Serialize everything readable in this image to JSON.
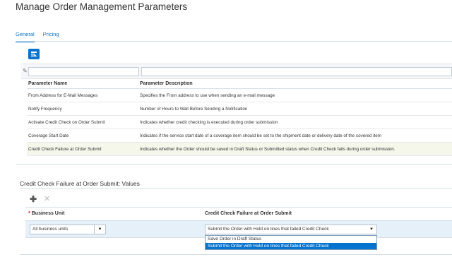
{
  "page": {
    "title": "Manage Order Management Parameters"
  },
  "tabs": [
    {
      "label": "General",
      "active": true
    },
    {
      "label": "Pricing",
      "active": false
    }
  ],
  "toolbar": {
    "action_icon": "edit-query-icon"
  },
  "grid": {
    "columns": [
      "Parameter Name",
      "Parameter Description"
    ],
    "rows": [
      {
        "name": "From Address for E-Mail Messages",
        "description": "Specifies the From address to use when sending an e-mail message"
      },
      {
        "name": "Notify Frequency",
        "description": "Number of Hours to Wait Before Sending a Notification"
      },
      {
        "name": "Activate Credit Check on Order Submit",
        "description": "Indicates whether credit checking is executed during order submission"
      },
      {
        "name": "Coverage Start Date",
        "description": "Indicates if the service start date of a coverage item should be set to the shipment date or delivery date of the covered item"
      },
      {
        "name": "Credit Check Failure at Order Submit",
        "description": "Indicates whether the Order should be saved in Draft Status or Submitted status when Credit Check fails during order submission."
      }
    ],
    "selected_row": 4
  },
  "values_section": {
    "title": "Credit Check Failure at Order Submit: Values",
    "columns": {
      "required_mark": "*",
      "business_unit": "Business Unit",
      "credit_check": "Credit Check Failure at Order Submit"
    },
    "row": {
      "business_unit": "All business units",
      "credit_check": "Submit the Order with Hold on lines that failed Credit Check"
    },
    "dropdown_options": [
      "Save Order in Draft Status",
      "Submit the Order with Hold on lines that failed Credit Check"
    ],
    "highlighted_option": 1
  },
  "colors": {
    "accent": "#0572ce",
    "selected_row": "#f4f7ea",
    "values_row": "#e6f0f8"
  }
}
